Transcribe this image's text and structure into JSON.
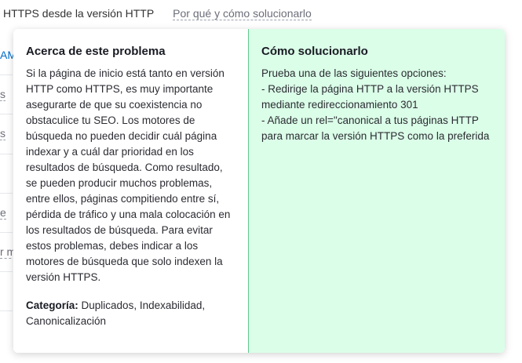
{
  "background": {
    "title": "HTTPS desde la versión HTTP",
    "link": "Por qué y cómo solucionarlo",
    "edge_fragments": [
      "AM",
      "s",
      "s",
      "e",
      "r m"
    ]
  },
  "popover": {
    "about": {
      "heading": "Acerca de este problema",
      "body": "Si la página de inicio está tanto en versión HTTP como HTTPS, es muy importante asegurarte de que su coexistencia no obstaculice tu SEO. Los motores de búsqueda no pueden decidir cuál página indexar y a cuál dar prioridad en los resultados de búsqueda. Como resultado, se pueden producir muchos problemas, entre ellos, páginas compitiendo entre sí, pérdida de tráfico y una mala colocación en los resultados de búsqueda. Para evitar estos problemas, debes indicar a los motores de búsqueda que solo indexen la versión HTTPS.",
      "category_label": "Categoría:",
      "category_value": "Duplicados, Indexabilidad, Canonicalización"
    },
    "fix": {
      "heading": "Cómo solucionarlo",
      "lines": [
        "Prueba una de las siguientes opciones:",
        "- Redirige la página HTTP a la versión HTTPS mediante redireccionamiento 301",
        "- Añade un rel=\"canonical a tus páginas HTTP para marcar la versión HTTPS como la preferida"
      ]
    }
  },
  "colors": {
    "fix_background": "#dbfee8",
    "fix_border": "#63c98d",
    "accent": "#006dca"
  }
}
